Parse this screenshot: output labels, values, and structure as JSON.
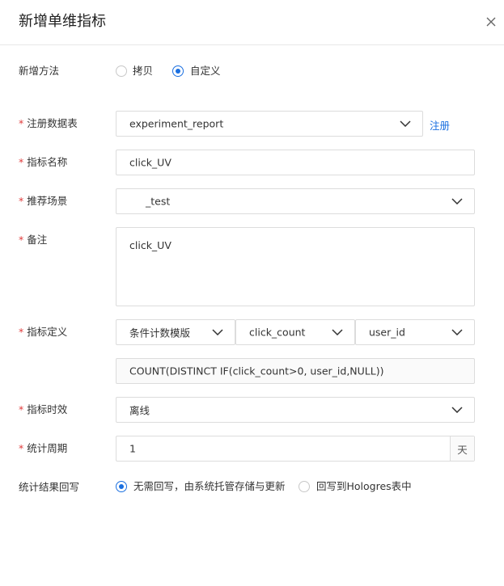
{
  "dialog": {
    "title": "新增单维指标"
  },
  "method": {
    "label": "新增方法",
    "options": [
      {
        "label": "拷贝",
        "checked": false
      },
      {
        "label": "自定义",
        "checked": true
      }
    ]
  },
  "table": {
    "label": "注册数据表",
    "value": "experiment_report",
    "register_link": "注册"
  },
  "metric_name": {
    "label": "指标名称",
    "value": "click_UV"
  },
  "scene": {
    "label": "推荐场景",
    "value": "_test"
  },
  "remark": {
    "label": "备注",
    "value": "click_UV"
  },
  "definition": {
    "label": "指标定义",
    "template": "条件计数模版",
    "count_field": "click_count",
    "id_field": "user_id",
    "expression": "COUNT(DISTINCT IF(click_count>0, user_id,NULL))"
  },
  "timeliness": {
    "label": "指标时效",
    "value": "离线"
  },
  "period": {
    "label": "统计周期",
    "value": "1",
    "unit": "天"
  },
  "writeback": {
    "label": "统计结果回写",
    "options": [
      {
        "label": "无需回写，由系统托管存储与更新",
        "checked": true
      },
      {
        "label": "回写到Hologres表中",
        "checked": false
      }
    ]
  }
}
